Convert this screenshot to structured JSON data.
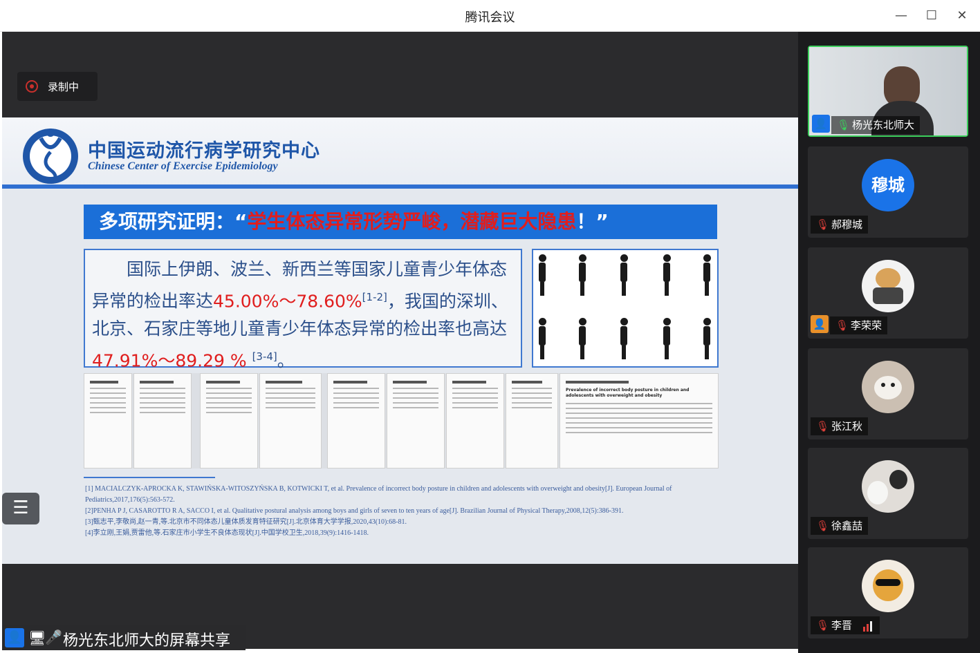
{
  "window": {
    "title": "腾讯会议",
    "minimize_glyph": "—",
    "maximize_glyph": "☐",
    "close_glyph": "✕"
  },
  "recording": {
    "label": "录制中"
  },
  "slide": {
    "org_cn": "中国运动流行病学研究中心",
    "org_en": "Chinese Center of Exercise Epidemiology",
    "banner_prefix": "多项研究证明：“",
    "banner_highlight": "学生体态异常形势严峻，潜藏巨大隐患",
    "banner_suffix": "！”",
    "body_p1": "国际上伊朗、波兰、新西兰等国家儿童青少年体态异常的检出率达",
    "body_v1": "45.00%～78.60%",
    "body_s1": "[1-2]",
    "body_p2": "，我国的深圳、北京、石家庄等地儿童青少年体态异常的检出率也高达",
    "body_v2": "47.91%～89.29 %",
    "body_s2": "[3-4]",
    "body_end": "。",
    "paper_title": "Prevalence of incorrect body posture in children and adolescents with overweight and obesity",
    "references": [
      "[1] MACIALCZYK-APROCKA K, STAWIŃSKA-WITOSZYŃSKA B, KOTWICKI T, et al. Prevalence of incorrect body posture in children and adolescents with overweight and obesity[J]. European Journal of Pediatrics,2017,176(5):563-572.",
      "[2]PENHA P J, CASAROTTO R A, SACCO I, et al. Qualitative postural analysis among boys and girls of seven to ten years of age[J]. Brazilian Journal of Physical Therapy,2008,12(5):386-391.",
      "[3]甄志平,李敬尚,赵一青,等.北京市不同体态儿童体质发育特征研究[J].北京体育大学学报,2020,43(10):68-81.",
      "[4]李立刚,王娟,贾雷他,等.石家庄市小学生不良体态现状[J].中国学校卫生,2018,39(9):1416-1418."
    ]
  },
  "menu_button": {
    "icon": "list-icon",
    "glyph": "☰"
  },
  "share_bar": {
    "label": "杨光东北师大的屏幕共享"
  },
  "participants": [
    {
      "name": "杨光东北师大",
      "avatar_text": "",
      "mic": "on",
      "active": true,
      "host": true,
      "color": "#6b7b86"
    },
    {
      "name": "郝穆城",
      "avatar_text": "穆城",
      "mic": "off",
      "active": false,
      "host": false,
      "color": "#1a73e8"
    },
    {
      "name": "李荣荣",
      "avatar_text": "",
      "mic": "off",
      "active": false,
      "host": true,
      "color": "#f0f0f0"
    },
    {
      "name": "张江秋",
      "avatar_text": "",
      "mic": "off",
      "active": false,
      "host": false,
      "color": "#c9bfb4"
    },
    {
      "name": "徐鑫喆",
      "avatar_text": "",
      "mic": "off",
      "active": false,
      "host": false,
      "color": "#d9d6d2"
    },
    {
      "name": "李晋",
      "avatar_text": "",
      "mic": "off",
      "active": false,
      "host": false,
      "color": "#e8e2d8"
    }
  ],
  "colors": {
    "accent_blue": "#1b6fd8",
    "highlight_red": "#e01e1e",
    "mic_on": "#3ccf5c",
    "mic_off": "#e0403a"
  }
}
